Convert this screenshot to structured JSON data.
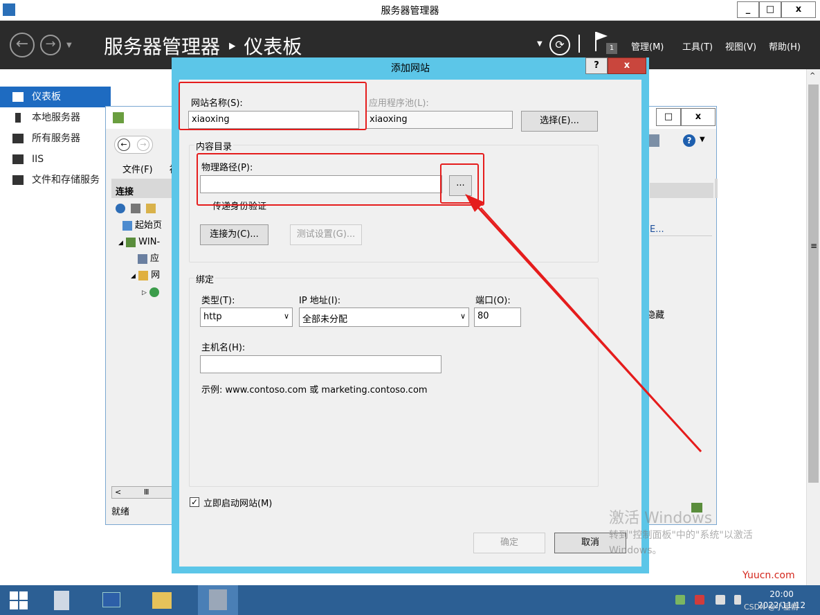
{
  "server_manager": {
    "window_title": "服务器管理器",
    "breadcrumb": "服务器管理器 ‣ 仪表板",
    "menus": [
      "管理(M)",
      "工具(T)",
      "视图(V)",
      "帮助(H)"
    ],
    "flag_badge": "1",
    "nav": [
      {
        "label": "仪表板",
        "active": true
      },
      {
        "label": "本地服务器"
      },
      {
        "label": "所有服务器"
      },
      {
        "label": "IIS"
      },
      {
        "label": "文件和存储服务"
      }
    ]
  },
  "iis_manager": {
    "menu_file": "文件(F)",
    "menu_view": "视",
    "connections_header": "连接",
    "tree": [
      "起始页",
      "WIN-",
      "应",
      "网",
      ""
    ],
    "status": "就绪",
    "right_link": "E...",
    "hide_label": "隐藏"
  },
  "dialog": {
    "title": "添加网站",
    "help": "?",
    "close": "x",
    "site_name_label": "网站名称(S):",
    "site_name_value": "xiaoxing",
    "app_pool_label": "应用程序池(L):",
    "app_pool_value": "xiaoxing",
    "select_button": "选择(E)...",
    "content_dir_group": "内容目录",
    "physical_path_label": "物理路径(P):",
    "physical_path_value": "",
    "browse_button": "...",
    "pass_auth_label": "传递身份验证",
    "connect_as_button": "连接为(C)...",
    "test_settings_button": "测试设置(G)...",
    "binding_group": "绑定",
    "type_label": "类型(T):",
    "type_value": "http",
    "ip_label": "IP 地址(I):",
    "ip_value": "全部未分配",
    "port_label": "端口(O):",
    "port_value": "80",
    "hostname_label": "主机名(H):",
    "hostname_value": "",
    "example_text": "示例: www.contoso.com 或 marketing.contoso.com",
    "start_site_label": "立即启动网站(M)",
    "start_site_checked": true,
    "ok_button": "确定",
    "cancel_button": "取消"
  },
  "watermark": {
    "line1": "激活 Windows",
    "line2": "转到\"控制面板\"中的\"系统\"以激活 Windows。",
    "site": "Yuucn.com"
  },
  "taskbar": {
    "time": "20:00",
    "date": "2022/11/12",
    "csdn": "CSDN @小星情"
  },
  "colors": {
    "dialog_frame": "#5cc6e8",
    "annotation_red": "#e51c1c",
    "nav_active": "#1e6bc1",
    "taskbar": "#2c5f94"
  }
}
